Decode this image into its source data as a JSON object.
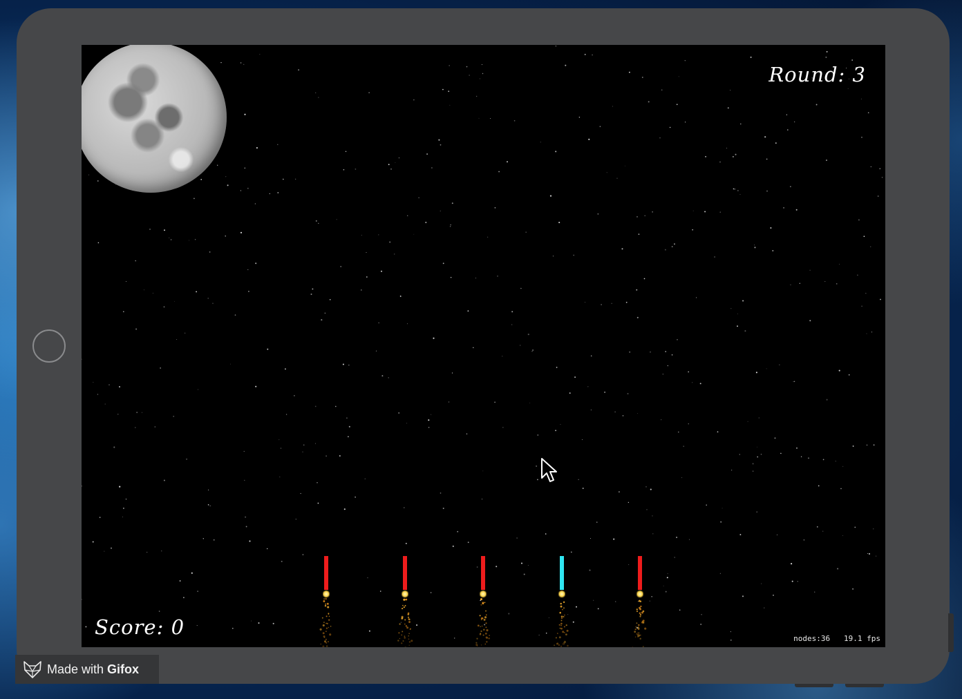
{
  "hud": {
    "round_label": "Round: 3",
    "score_label": "Score: 0",
    "debug_nodes": "nodes:36",
    "debug_fps": "19.1 fps"
  },
  "rockets": [
    {
      "color": "#ee1c1c"
    },
    {
      "color": "#ee1c1c"
    },
    {
      "color": "#ee1c1c"
    },
    {
      "color": "#2fe6f2"
    },
    {
      "color": "#ee1c1c"
    }
  ],
  "watermark": {
    "prefix": "Made with ",
    "brand": "Gifox",
    "icon": "fox-head-icon"
  },
  "colors": {
    "device_frame": "#464749",
    "screen_background": "#000000",
    "rocket_red": "#ee1c1c",
    "rocket_cyan": "#2fe6f2",
    "exhaust": "#ffb52e"
  }
}
